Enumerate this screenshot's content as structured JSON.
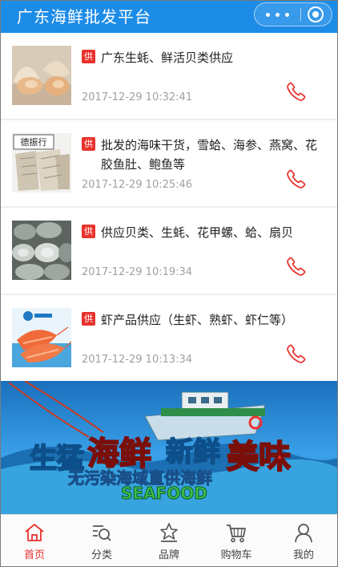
{
  "header": {
    "title": "广东海鲜批发平台"
  },
  "items": [
    {
      "tag": "供",
      "title": "广东生蚝、鲜活贝类供应",
      "time": "2017-12-29 10:32:41"
    },
    {
      "tag": "供",
      "title": "批发的海味干货，雪蛤、海参、燕窝、花胶鱼肚、鲍鱼等",
      "time": "2017-12-29 10:25:46",
      "thumb_label": "德振行"
    },
    {
      "tag": "供",
      "title": "供应贝类、生蚝、花甲螺、蛤、扇贝",
      "time": "2017-12-29 10:19:34"
    },
    {
      "tag": "供",
      "title": "虾产品供应（生虾、熟虾、虾仁等）",
      "time": "2017-12-29 10:13:34"
    }
  ],
  "banner": {
    "line1_a": "生猛",
    "line1_b": "海鲜",
    "line1_c": "新鲜",
    "line1_d": "美味",
    "line2": "无污染海域直供海鲜",
    "line3": "SEAFOOD"
  },
  "tabbar": [
    {
      "label": "首页",
      "icon": "home-icon",
      "active": true
    },
    {
      "label": "分类",
      "icon": "category-search-icon",
      "active": false
    },
    {
      "label": "品牌",
      "icon": "brand-icon",
      "active": false
    },
    {
      "label": "购物车",
      "icon": "cart-icon",
      "active": false
    },
    {
      "label": "我的",
      "icon": "user-icon",
      "active": false
    }
  ],
  "colors": {
    "header": "#1c8ce7",
    "accent": "#e8322d",
    "time": "#a0a0a0"
  }
}
